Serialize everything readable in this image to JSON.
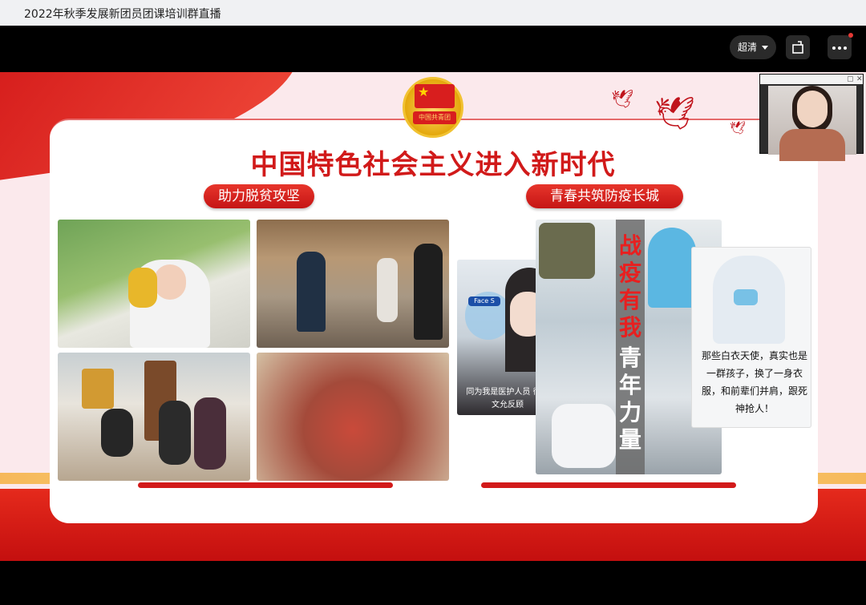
{
  "window": {
    "title": "2022年秋季发展新团员团课培训群直播"
  },
  "controls": {
    "quality_label": "超清",
    "icons": [
      "chevron-down-icon",
      "share-icon",
      "more-icon",
      "notification-dot-icon"
    ]
  },
  "slide": {
    "emblem_text": "中国共青团",
    "headline": "中国特色社会主义进入新时代",
    "left_section": {
      "label": "助力脱贫攻坚"
    },
    "right_section": {
      "label": "青春共筑防疫长城"
    },
    "face_shield_text": "Face S",
    "poster_caption": "同为我是医护人员  衍以文允反顾",
    "vertical_red": "战疫有我",
    "vertical_white": "青年力量",
    "handwritten_note": "那些白衣天使，真实也是一群孩子，换了一身衣服，和前辈们并肩，跟死神抢人！"
  },
  "webcam": {
    "icons": [
      "restore-icon",
      "close-icon"
    ]
  },
  "colors": {
    "accent_red": "#d11a1a",
    "gold": "#f1c232",
    "titlebar_bg": "#f0f1f3",
    "player_bg": "#000000"
  }
}
